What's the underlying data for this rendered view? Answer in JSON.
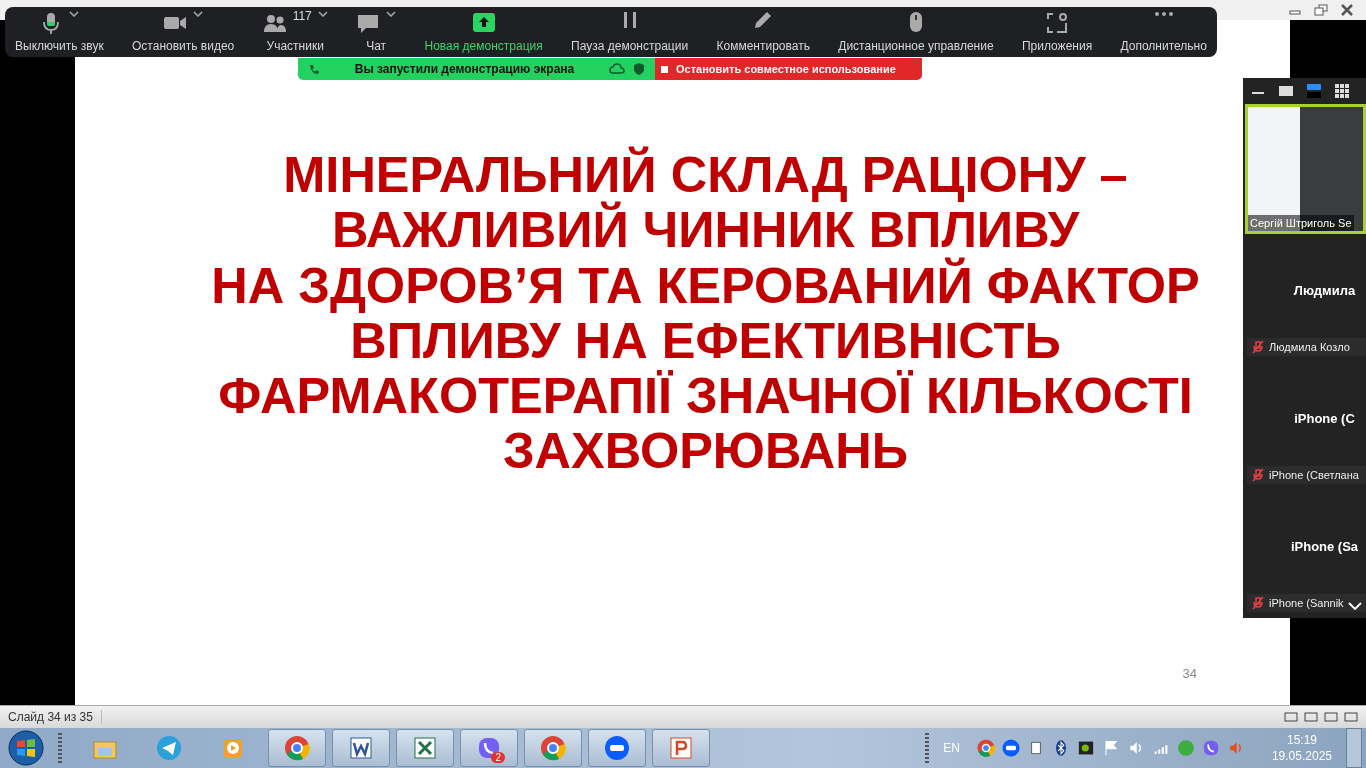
{
  "toolbar": {
    "items": [
      {
        "kind": "mic",
        "label": "Выключить звук",
        "caret": true,
        "highlighted": false
      },
      {
        "kind": "video",
        "label": "Остановить видео",
        "caret": true,
        "highlighted": false
      },
      {
        "kind": "participants",
        "label": "Участники",
        "count": "117",
        "caret": true,
        "highlighted": false
      },
      {
        "kind": "chat",
        "label": "Чат",
        "caret": true,
        "highlighted": false
      },
      {
        "kind": "share",
        "label": "Новая демонстрация",
        "caret": false,
        "highlighted": true
      },
      {
        "kind": "pause",
        "label": "Пауза демонстрации",
        "caret": false,
        "highlighted": false
      },
      {
        "kind": "annotate",
        "label": "Комментировать",
        "caret": false,
        "highlighted": false
      },
      {
        "kind": "remote",
        "label": "Дистанционное управление",
        "caret": false,
        "highlighted": false
      },
      {
        "kind": "apps",
        "label": "Приложения",
        "caret": false,
        "highlighted": false
      },
      {
        "kind": "more",
        "label": "Дополнительно",
        "caret": false,
        "highlighted": false
      }
    ]
  },
  "share_banner": {
    "message": "Вы запустили демонстрацию экрана",
    "stop_label": "Остановить совместное использование"
  },
  "slide": {
    "title_lines": [
      "МІНЕРАЛЬНИЙ СКЛАД РАЦІОНУ –",
      "ВАЖЛИВИЙ ЧИННИК ВПЛИВУ",
      "НА ЗДОРОВ’Я ТА КЕРОВАНИЙ ФАКТОР",
      "ВПЛИВУ НА ЕФЕКТИВНІСТЬ",
      "ФАРМАКОТЕРАПІЇ ЗНАЧНОЇ КІЛЬКОСТІ",
      "ЗАХВОРЮВАНЬ"
    ],
    "number": "34"
  },
  "gallery": {
    "views": [
      {
        "kind": "minimize",
        "selected": false
      },
      {
        "kind": "speaker",
        "selected": false
      },
      {
        "kind": "strip",
        "selected": true
      },
      {
        "kind": "grid",
        "selected": false
      }
    ],
    "tiles": [
      {
        "kind": "video",
        "name": "Сергій Штриголь Se"
      },
      {
        "kind": "name",
        "display": "Людмила",
        "name": "Людмила Козло",
        "muted": true
      },
      {
        "kind": "name",
        "display": "iPhone  (C",
        "name": "iPhone (Светлана",
        "muted": true
      },
      {
        "kind": "name",
        "display": "iPhone  (Sa",
        "name": "iPhone (Sannik",
        "muted": true
      }
    ]
  },
  "status_bar": {
    "text": "Слайд 34 из 35"
  },
  "taskbar": {
    "apps": [
      {
        "kind": "explorer",
        "running": false
      },
      {
        "kind": "telegram",
        "running": false
      },
      {
        "kind": "media",
        "running": false
      },
      {
        "kind": "chrome",
        "running": true
      },
      {
        "kind": "word",
        "running": true
      },
      {
        "kind": "excel",
        "running": true
      },
      {
        "kind": "viber",
        "running": true,
        "badge": "2"
      },
      {
        "kind": "chrome",
        "running": true
      },
      {
        "kind": "zoom",
        "running": true
      },
      {
        "kind": "powerpoint",
        "running": true
      }
    ],
    "language": "EN",
    "time": "15:19",
    "date": "19.05.2025"
  }
}
